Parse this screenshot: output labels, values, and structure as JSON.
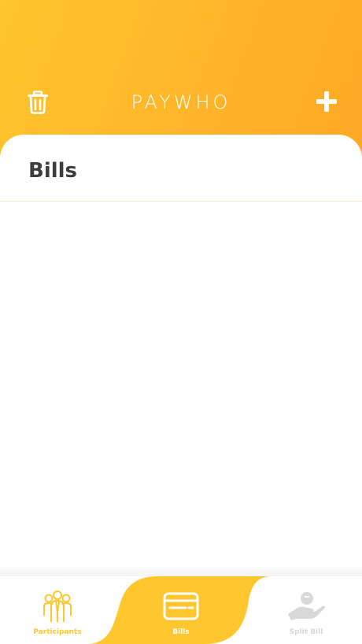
{
  "header": {
    "title": "PAYWHO",
    "left_icon": "trash-icon",
    "right_icon": "plus-icon"
  },
  "main": {
    "section_title": "Bills",
    "items": []
  },
  "tabbar": {
    "active": "Bills",
    "tabs": [
      {
        "label": "Participants",
        "icon": "participants-icon",
        "state": "inactive"
      },
      {
        "label": "Bills",
        "icon": "credit-card-icon",
        "state": "active"
      },
      {
        "label": "Split Bill",
        "icon": "hand-coin-icon",
        "state": "disabled"
      }
    ]
  },
  "colors": {
    "accent": "#ffc62d",
    "accent_dark": "#ffa825",
    "title_text": "#3d3d3d",
    "inactive_tab": "#d8d8d8",
    "divider": "#fde6bf"
  }
}
